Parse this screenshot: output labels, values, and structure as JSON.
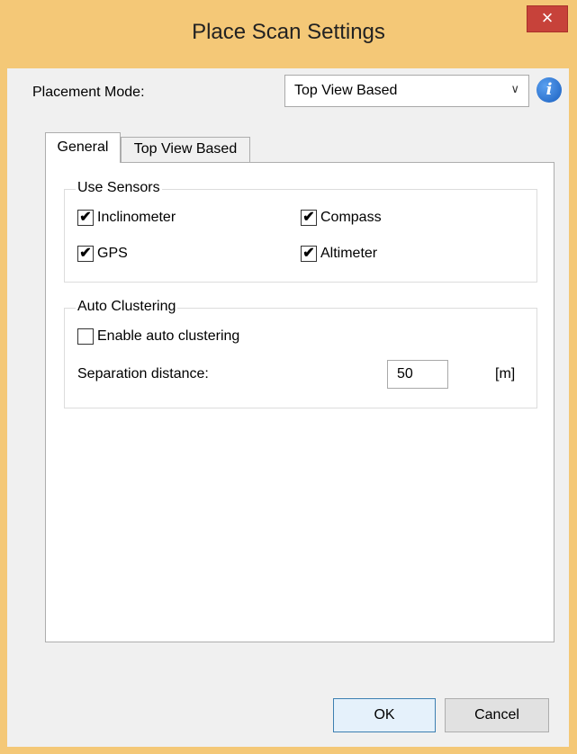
{
  "window": {
    "title": "Place Scan Settings",
    "close_glyph": "×"
  },
  "placement": {
    "label": "Placement Mode:",
    "selected": "Top View Based",
    "info_glyph": "i"
  },
  "tabs": [
    {
      "label": "General",
      "active": true
    },
    {
      "label": "Top View Based",
      "active": false
    }
  ],
  "use_sensors": {
    "title": "Use Sensors",
    "items": [
      {
        "label": "Inclinometer",
        "checked": true
      },
      {
        "label": "Compass",
        "checked": true
      },
      {
        "label": "GPS",
        "checked": true
      },
      {
        "label": "Altimeter",
        "checked": true
      }
    ]
  },
  "auto_clustering": {
    "title": "Auto Clustering",
    "enable_label": "Enable auto clustering",
    "enable_checked": false,
    "separation_label": "Separation distance:",
    "separation_value": "50",
    "unit": "[m]"
  },
  "buttons": {
    "ok": "OK",
    "cancel": "Cancel"
  },
  "colors": {
    "frame": "#f4c877",
    "close": "#c7423a",
    "info": "#1a5fbf"
  },
  "icons": [
    "close-icon",
    "info-icon",
    "chevron-down-icon",
    "checkmark-icon"
  ]
}
